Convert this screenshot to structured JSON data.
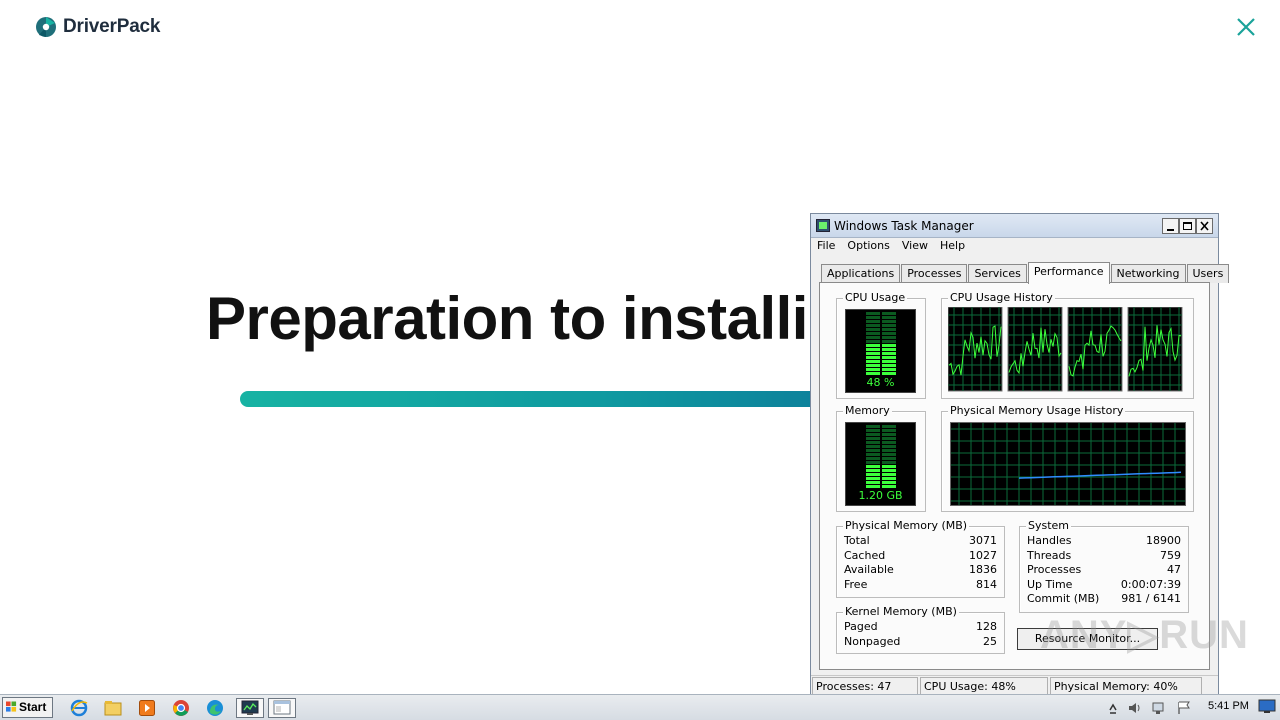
{
  "app": {
    "brand": "DriverPack",
    "title": "Preparation to installi",
    "progress": 1.0
  },
  "task_manager": {
    "title": "Windows Task Manager",
    "menu": [
      "File",
      "Options",
      "View",
      "Help"
    ],
    "tabs": [
      "Applications",
      "Processes",
      "Services",
      "Performance",
      "Networking",
      "Users"
    ],
    "active_tab": "Performance",
    "cpu_usage": {
      "label": "CPU Usage",
      "value": "48 %",
      "level": 0.48
    },
    "cpu_history": {
      "label": "CPU Usage History",
      "cores": 4
    },
    "memory": {
      "label": "Memory",
      "value": "1.20 GB",
      "level": 0.4
    },
    "memory_history": {
      "label": "Physical Memory Usage History"
    },
    "physical_memory": {
      "label": "Physical Memory (MB)",
      "rows": [
        {
          "k": "Total",
          "v": "3071"
        },
        {
          "k": "Cached",
          "v": "1027"
        },
        {
          "k": "Available",
          "v": "1836"
        },
        {
          "k": "Free",
          "v": "814"
        }
      ]
    },
    "kernel_memory": {
      "label": "Kernel Memory (MB)",
      "rows": [
        {
          "k": "Paged",
          "v": "128"
        },
        {
          "k": "Nonpaged",
          "v": "25"
        }
      ]
    },
    "system": {
      "label": "System",
      "rows": [
        {
          "k": "Handles",
          "v": "18900"
        },
        {
          "k": "Threads",
          "v": "759"
        },
        {
          "k": "Processes",
          "v": "47"
        },
        {
          "k": "Up Time",
          "v": "0:00:07:39"
        },
        {
          "k": "Commit (MB)",
          "v": "981 / 6141"
        }
      ]
    },
    "resource_monitor_button": "Resource Monitor...",
    "status": {
      "processes": "Processes: 47",
      "cpu": "CPU Usage: 48%",
      "memory": "Physical Memory: 40%"
    }
  },
  "watermark": "ANY.RUN",
  "taskbar": {
    "start_label": "Start",
    "clock": "5:41 PM",
    "apps": [
      "ie-icon",
      "explorer-folder-icon",
      "media-player-icon",
      "chrome-icon",
      "edge-icon",
      "task-manager-icon",
      "driverpack-window-icon"
    ]
  },
  "colors": {
    "accent_start": "#17b3a3",
    "accent_end": "#0d7f9b",
    "meter_green": "#3cff3c",
    "graph_grid": "#0b6b3a",
    "mem_line": "#2f8cff"
  }
}
